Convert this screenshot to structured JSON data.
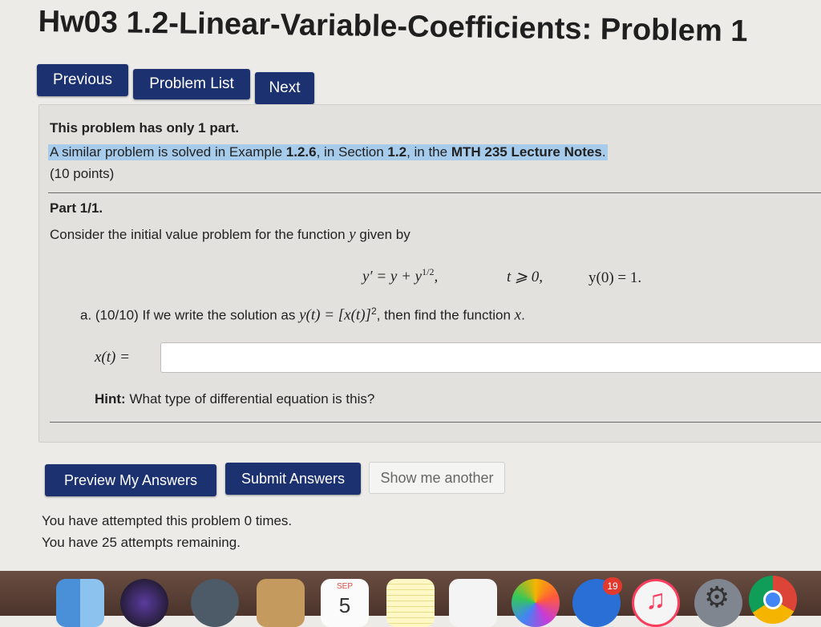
{
  "page": {
    "title": "Hw03 1.2-Linear-Variable-Coefficients: Problem 1"
  },
  "nav": {
    "previous": "Previous",
    "problem_list": "Problem List",
    "next": "Next"
  },
  "problem": {
    "parts_text": "This problem has only 1 part.",
    "similar_prefix": "A similar problem is solved in Example ",
    "example_ref": "1.2.6",
    "similar_mid1": ", in Section ",
    "section_ref": "1.2",
    "similar_mid2": ", in the ",
    "notes_link": "MTH 235 Lecture Notes",
    "similar_suffix": ".",
    "points": "(10 points)",
    "part_label": "Part 1/1.",
    "prompt_prefix": "Consider the initial value problem for the function ",
    "prompt_var": "y",
    "prompt_suffix": " given by",
    "eq_lhs": "y′ = y + y",
    "eq_exp": "1/2",
    "eq_comma": ",",
    "eq_cond": "t ⩾ 0,",
    "eq_initial": "y(0) = 1.",
    "q_a_prefix": "a. (10/10) If we write the solution as ",
    "q_a_math": "y(t) = [x(t)]",
    "q_a_exp": "2",
    "q_a_suffix_pre": ", then find the function ",
    "q_a_var": "x",
    "q_a_period": ".",
    "answer_label": "x(t) =",
    "answer_value": "",
    "hint_label": "Hint:",
    "hint_text": " What type of differential equation is this?"
  },
  "actions": {
    "preview": "Preview My Answers",
    "submit": "Submit Answers",
    "another": "Show me another"
  },
  "status": {
    "attempts": "You have attempted this problem 0 times.",
    "remaining": "You have 25 attempts remaining."
  },
  "dock": {
    "calendar_month": "SEP",
    "calendar_day": "5",
    "app_store_badge": "19",
    "items": [
      "finder-icon",
      "siri-icon",
      "launchpad-icon",
      "contacts-icon",
      "calendar-icon",
      "notes-icon",
      "reminders-icon",
      "photos-icon",
      "facetime-icon",
      "itunes-icon",
      "system-preferences-icon",
      "chrome-icon"
    ]
  },
  "colors": {
    "button": "#1c3170",
    "highlight": "#a7cbeb",
    "dock": "#5a4035"
  }
}
